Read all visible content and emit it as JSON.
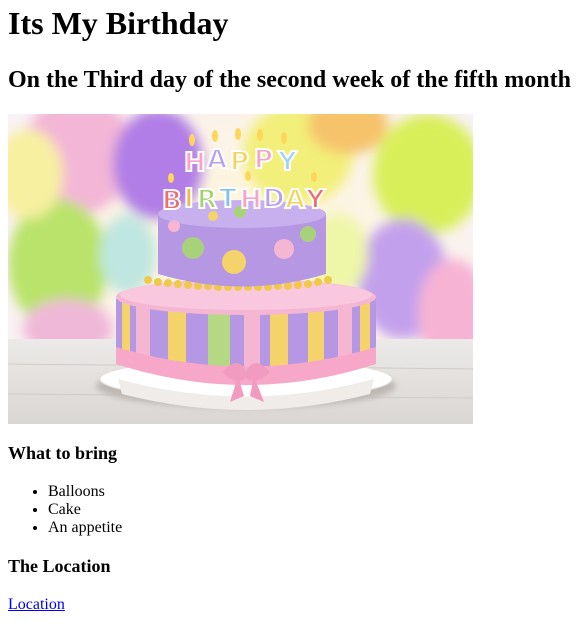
{
  "title": "Its My Birthday",
  "subtitle": "On the Third day of the second week of the fifth month",
  "image": {
    "candle_letters_top": [
      "H",
      "A",
      "P",
      "P",
      "Y"
    ],
    "candle_letters_bottom": [
      "B",
      "I",
      "R",
      "T",
      "H",
      "D",
      "A",
      "Y"
    ],
    "icon": "birthday-cake-image"
  },
  "bring": {
    "heading": "What to bring",
    "items": [
      "Balloons",
      "Cake",
      "An appetite"
    ]
  },
  "location": {
    "heading": "The Location",
    "link_label": "Location"
  },
  "colors": {
    "link": "#0000ee"
  }
}
